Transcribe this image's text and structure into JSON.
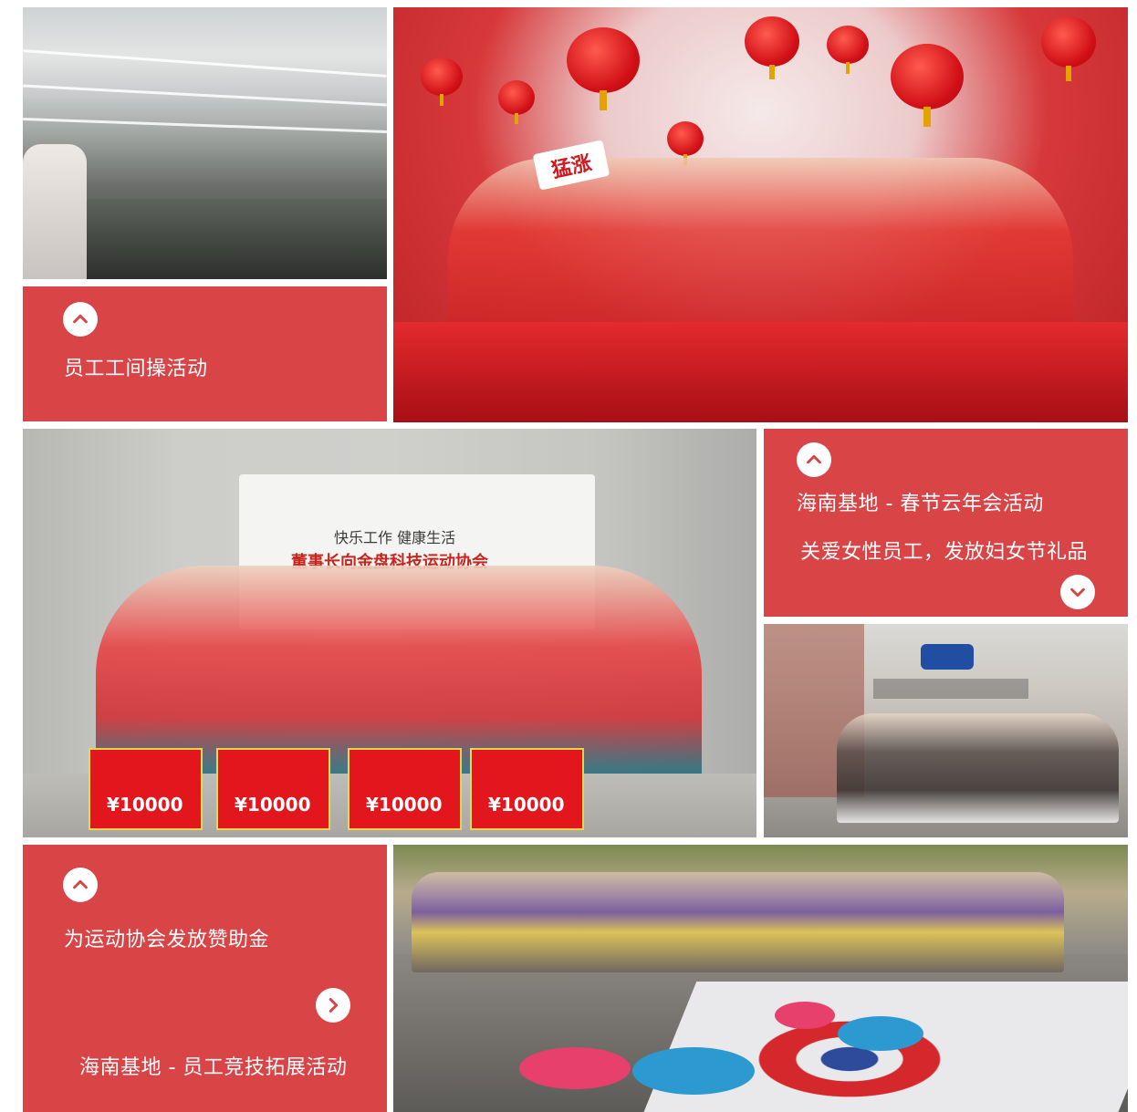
{
  "captions": {
    "exercise": "员工工间操活动",
    "spring_festival": "海南基地 - 春节云年会活动",
    "womens_day": "关爱女性员工，发放妇女节礼品",
    "sponsorship": "为运动协会发放赞助金",
    "team_building": "海南基地 - 员工竞技拓展活动"
  },
  "photos": {
    "exercise_photo_label": "员工工间操活动",
    "party_photo_label": "海南基地 - 春节云年会活动",
    "sports_photo_label": "为运动协会发放赞助金",
    "gifts_photo_label": "关爱女性员工，发放妇女节礼品",
    "teambuilding_photo_label": "海南基地 - 员工竞技拓展活动"
  },
  "photo_text": {
    "banner_slogan": "快乐工作 健康生活",
    "banner_title": "董事长向金盘科技运动协会",
    "cheque_amount": "¥10000",
    "sign_up": "猛涨"
  },
  "icons": {
    "up": "chevron-up-icon",
    "down": "chevron-down-icon",
    "right": "chevron-right-icon"
  },
  "colors": {
    "accent": "#d94446",
    "text_on_accent": "#ffffff"
  }
}
